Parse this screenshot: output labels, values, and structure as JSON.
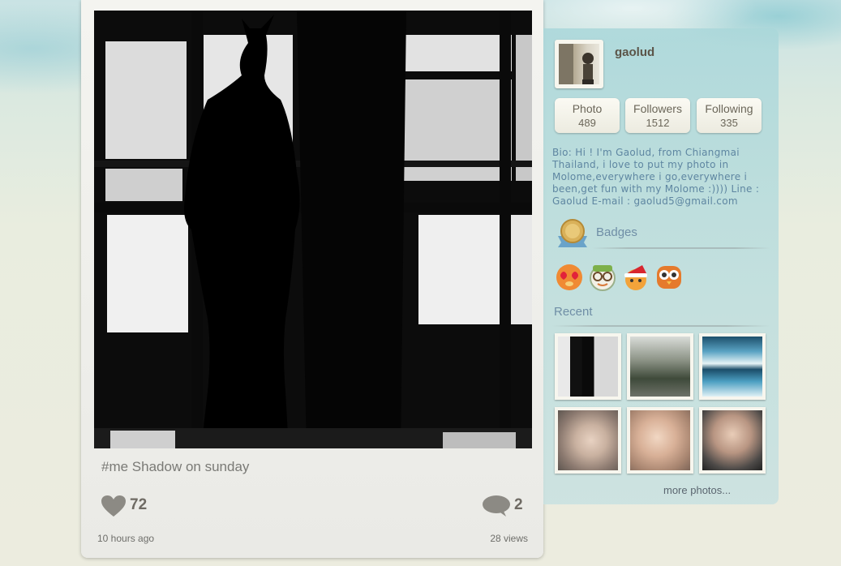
{
  "post": {
    "caption": "#me Shadow on sunday",
    "likes": "72",
    "comments": "2",
    "time_ago": "10 hours ago",
    "views": "28 views"
  },
  "profile": {
    "username": "gaolud",
    "stats": [
      {
        "label": "Photo",
        "value": "489"
      },
      {
        "label": "Followers",
        "value": "1512"
      },
      {
        "label": "Following",
        "value": "335"
      }
    ],
    "bio": "Bio: Hi ! I'm Gaolud, from Chiangmai Thailand, i love to put my photo in Molome,everywhere i go,everywhere i been,get fun with my Molome :)))) Line : Gaolud E-mail : gaolud5@gmail.com"
  },
  "badges": {
    "title": "Badges",
    "items": [
      "heart-eyes-badge-icon",
      "glasses-badge-icon",
      "santa-badge-icon",
      "owl-badge-icon"
    ]
  },
  "recent": {
    "title": "Recent",
    "more_label": "more photos..."
  },
  "colors": {
    "accent_text": "#5e86a1",
    "sidebar_bg": "#aad7da"
  }
}
